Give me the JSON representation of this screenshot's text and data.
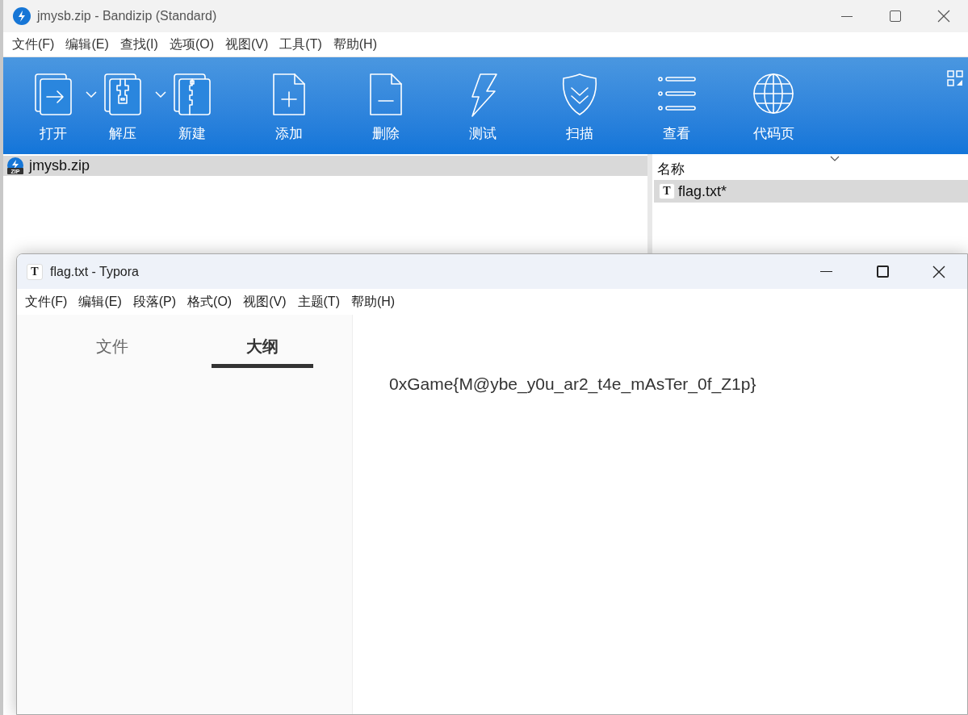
{
  "bandizip": {
    "title": "jmysb.zip - Bandizip (Standard)",
    "menu": [
      "文件(F)",
      "编辑(E)",
      "查找(I)",
      "选项(O)",
      "视图(V)",
      "工具(T)",
      "帮助(H)"
    ],
    "toolbar": [
      {
        "label": "打开",
        "kind": "open",
        "dropdown": true
      },
      {
        "label": "解压",
        "kind": "extract",
        "dropdown": true
      },
      {
        "label": "新建",
        "kind": "new",
        "dropdown": false
      },
      {
        "label": "添加",
        "kind": "add",
        "dropdown": false
      },
      {
        "label": "删除",
        "kind": "delete",
        "dropdown": false
      },
      {
        "label": "测试",
        "kind": "test",
        "dropdown": false
      },
      {
        "label": "扫描",
        "kind": "scan",
        "dropdown": false
      },
      {
        "label": "查看",
        "kind": "view",
        "dropdown": false
      },
      {
        "label": "代码页",
        "kind": "codepage",
        "dropdown": false
      }
    ],
    "archive_tree": [
      {
        "label": "jmysb.zip",
        "selected": true,
        "icon_text": "ZIP"
      }
    ],
    "file_list": {
      "column": "名称",
      "rows": [
        {
          "name": "flag.txt*",
          "selected": true,
          "icon_text": "T"
        }
      ]
    }
  },
  "typora": {
    "title": "flag.txt - Typora",
    "icon_text": "T",
    "menu": [
      "文件(F)",
      "编辑(E)",
      "段落(P)",
      "格式(O)",
      "视图(V)",
      "主题(T)",
      "帮助(H)"
    ],
    "sidebar_tabs": [
      {
        "label": "文件",
        "selected": false
      },
      {
        "label": "大纲",
        "selected": true
      }
    ],
    "content": "0xGame{M@ybe_y0u_ar2_t4e_mAsTer_0f_Z1p}"
  }
}
